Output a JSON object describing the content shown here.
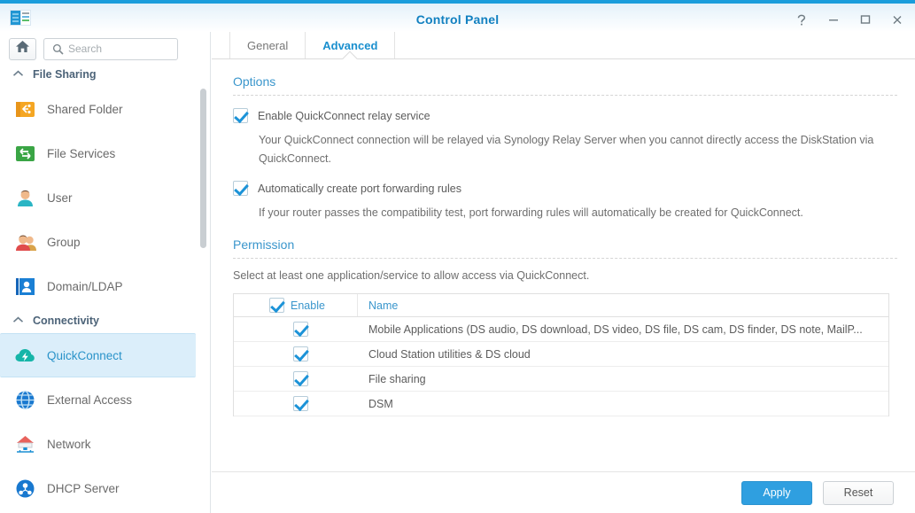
{
  "window": {
    "title": "Control Panel",
    "app_icon": "control-panel-icon",
    "controls": [
      {
        "name": "help-button",
        "glyph": "?"
      },
      {
        "name": "minimize-button",
        "glyph": "–"
      },
      {
        "name": "maximize-button",
        "glyph": "▭"
      },
      {
        "name": "close-button",
        "glyph": "✕"
      }
    ]
  },
  "sidebar": {
    "home_button": "home-icon",
    "search": {
      "placeholder": "Search",
      "value": "",
      "icon": "search-icon"
    },
    "groups": [
      {
        "label": "File Sharing",
        "chevron": "chevron-up-icon",
        "items": [
          {
            "label": "Shared Folder",
            "icon": "shared-folder-icon",
            "selected": false
          },
          {
            "label": "File Services",
            "icon": "file-services-icon",
            "selected": false
          },
          {
            "label": "User",
            "icon": "user-icon",
            "selected": false
          },
          {
            "label": "Group",
            "icon": "group-icon",
            "selected": false
          },
          {
            "label": "Domain/LDAP",
            "icon": "domain-ldap-icon",
            "selected": false
          }
        ]
      },
      {
        "label": "Connectivity",
        "chevron": "chevron-up-icon",
        "items": [
          {
            "label": "QuickConnect",
            "icon": "quickconnect-icon",
            "selected": true
          },
          {
            "label": "External Access",
            "icon": "external-access-icon",
            "selected": false
          },
          {
            "label": "Network",
            "icon": "network-icon",
            "selected": false
          },
          {
            "label": "DHCP Server",
            "icon": "dhcp-server-icon",
            "selected": false
          }
        ]
      }
    ]
  },
  "tabs": [
    {
      "label": "General",
      "active": false
    },
    {
      "label": "Advanced",
      "active": true
    }
  ],
  "options": {
    "title": "Options",
    "items": [
      {
        "label": "Enable QuickConnect relay service",
        "checked": true,
        "description": "Your QuickConnect connection will be relayed via Synology Relay Server when you cannot directly access the DiskStation via QuickConnect."
      },
      {
        "label": "Automatically create port forwarding rules",
        "checked": true,
        "description": "If your router passes the compatibility test, port forwarding rules will automatically be created for QuickConnect."
      }
    ]
  },
  "permission": {
    "title": "Permission",
    "hint": "Select at least one application/service to allow access via QuickConnect.",
    "columns": {
      "enable": "Enable",
      "name": "Name"
    },
    "header_checked": true,
    "rows": [
      {
        "checked": true,
        "name": "Mobile Applications (DS audio, DS download, DS video, DS file, DS cam, DS finder, DS note, MailP..."
      },
      {
        "checked": true,
        "name": "Cloud Station utilities & DS cloud"
      },
      {
        "checked": true,
        "name": "File sharing"
      },
      {
        "checked": true,
        "name": "DSM"
      }
    ]
  },
  "footer": {
    "apply_label": "Apply",
    "reset_label": "Reset"
  },
  "colors": {
    "accent": "#1a9ddc",
    "title_text": "#1180c0",
    "section_title": "#3a96cc",
    "selected_bg": "#dbeefa",
    "apply_bg": "#2f9fe0"
  }
}
